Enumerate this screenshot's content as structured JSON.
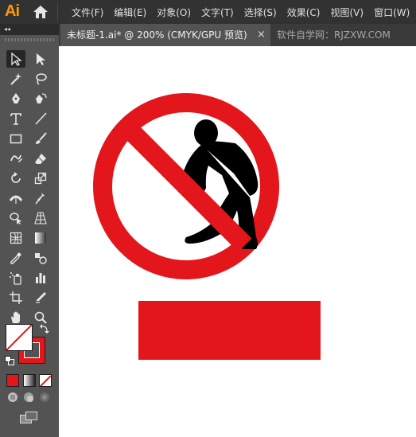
{
  "app": {
    "logo": "Ai"
  },
  "menu": {
    "items": [
      "文件(F)",
      "编辑(E)",
      "对象(O)",
      "文字(T)",
      "选择(S)",
      "效果(C)",
      "视图(V)",
      "窗口(W)"
    ]
  },
  "tabs": {
    "document": "未标题-1.ai* @ 200% (CMYK/GPU 预览)",
    "close": "×",
    "watermark": "软件自学网：RJZXW.COM"
  },
  "panel": {
    "collapse": "◂◂"
  },
  "colors": {
    "accent_red": "#e3161b",
    "menubar": "#323232",
    "toolbar": "#535353",
    "canvas": "#ffffff"
  },
  "icons": [
    "home-icon",
    "selection-tool-icon",
    "direct-selection-tool-icon",
    "magic-wand-icon",
    "lasso-icon",
    "pen-tool-icon",
    "curvature-tool-icon",
    "type-tool-icon",
    "line-tool-icon",
    "rectangle-tool-icon",
    "paintbrush-icon",
    "shaper-tool-icon",
    "eraser-icon",
    "rotate-tool-icon",
    "scale-tool-icon",
    "width-tool-icon",
    "puppet-warp-icon",
    "shape-builder-icon",
    "perspective-grid-icon",
    "mesh-tool-icon",
    "gradient-tool-icon",
    "eyedropper-icon",
    "blend-tool-icon",
    "symbol-sprayer-icon",
    "column-graph-icon",
    "artboard-tool-icon",
    "slice-tool-icon",
    "hand-tool-icon",
    "zoom-tool-icon",
    "swap-colors-icon",
    "default-colors-icon",
    "change-screen-mode-icon"
  ]
}
